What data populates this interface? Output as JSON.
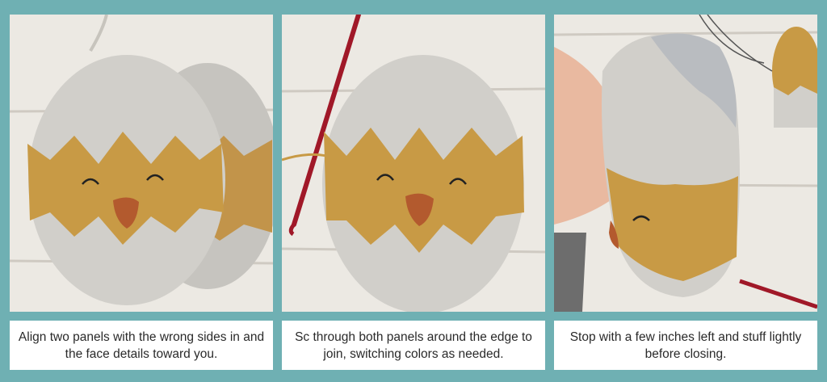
{
  "steps": [
    {
      "photo": "two crocheted egg-shaped chick panels stacked on white wood",
      "caption": "Align two panels with the wrong sides in and the face details toward you."
    },
    {
      "photo": "joined chick panel with a red crochet hook on white wood",
      "caption": "Sc through both panels around the edge to join, switching colors as needed."
    },
    {
      "photo": "hand holding partly joined panel being stuffed with fiberfill",
      "caption": "Stop with a few inches left and stuff lightly before closing."
    }
  ],
  "colors": {
    "frame": "#6fb0b3",
    "egg_shell": "#c9c7c2",
    "chick_yellow": "#c89a45",
    "beak": "#b35a2e",
    "wood": "#ebe9e4",
    "hook": "#a01828"
  }
}
